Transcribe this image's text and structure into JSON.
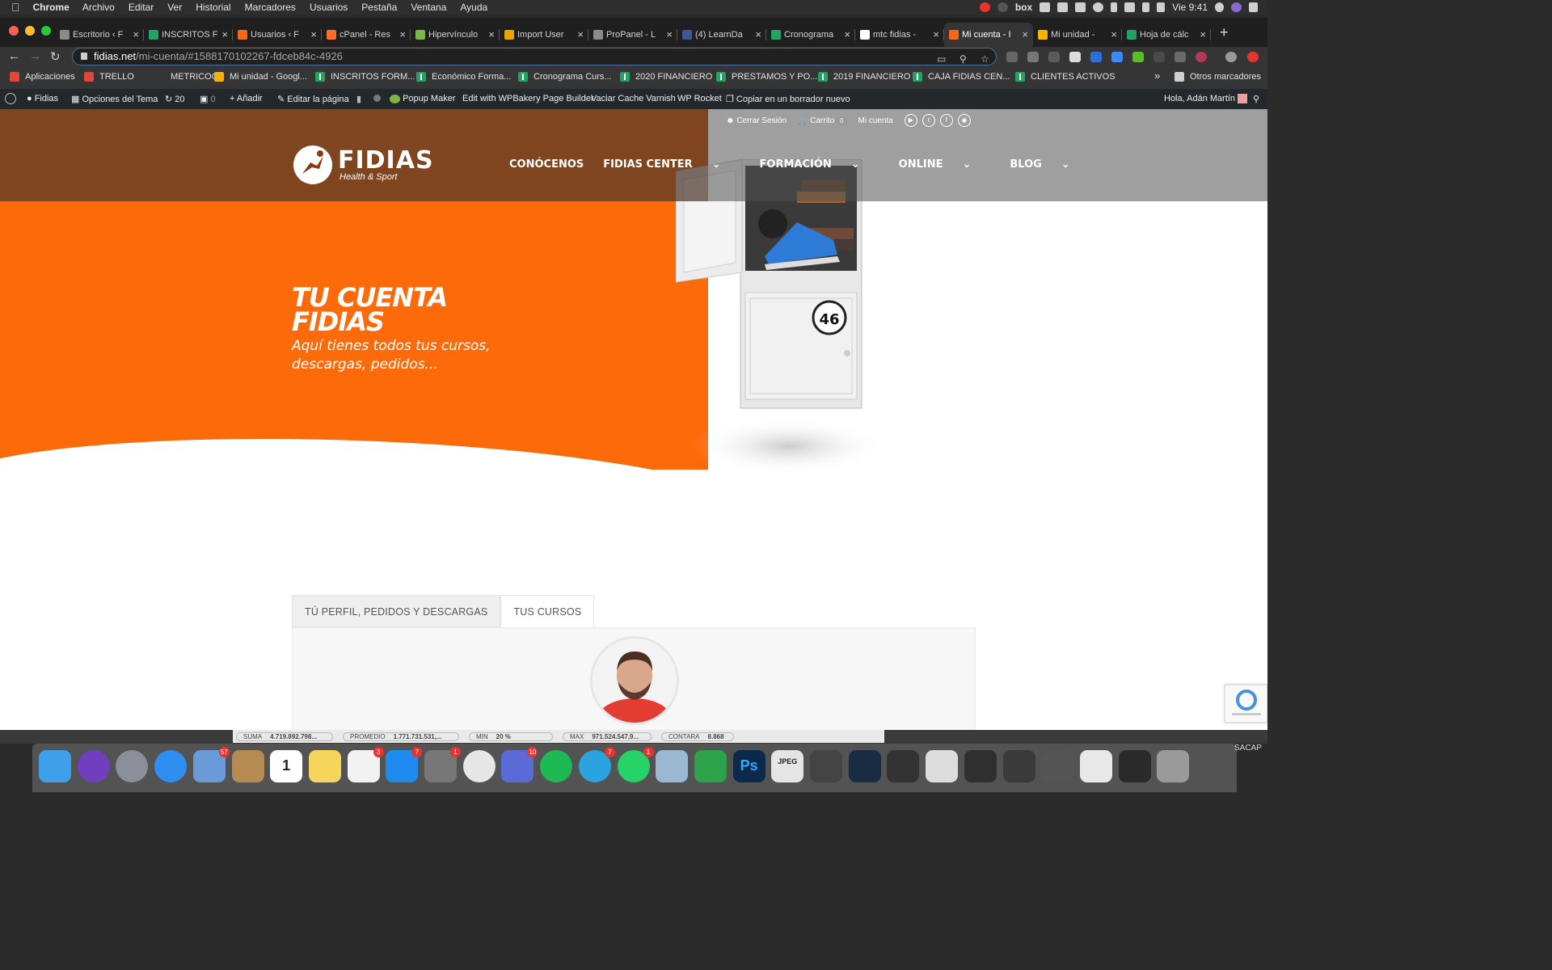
{
  "menubar": {
    "app": "Chrome",
    "items": [
      "Archivo",
      "Editar",
      "Ver",
      "Historial",
      "Marcadores",
      "Usuarios",
      "Pestaña",
      "Ventana",
      "Ayuda"
    ],
    "box_label": "box",
    "clock": "Vie 9:41"
  },
  "tabs": [
    {
      "label": "Escritorio ‹ F",
      "fav": "#8a8a8a"
    },
    {
      "label": "INSCRITOS F",
      "fav": "#1fa463"
    },
    {
      "label": "Usuarios ‹ F",
      "fav": "#f26a18"
    },
    {
      "label": "cPanel - Res",
      "fav": "#ff6c2c"
    },
    {
      "label": "Hipervínculo",
      "fav": "#7ab648"
    },
    {
      "label": "Import User",
      "fav": "#e9a400"
    },
    {
      "label": "ProPanel - L",
      "fav": "#8a8a8a"
    },
    {
      "label": "(4) LearnDa",
      "fav": "#3b5998"
    },
    {
      "label": "Cronograma",
      "fav": "#1fa463"
    },
    {
      "label": "mtc fidias -",
      "fav": "#ffffff"
    },
    {
      "label": "Mi cuenta - I",
      "fav": "#f26a18",
      "active": true
    },
    {
      "label": "Mi unidad -",
      "fav": "#f4b400"
    },
    {
      "label": "Hoja de cálc",
      "fav": "#1fa463"
    }
  ],
  "address": {
    "domain": "fidias.net",
    "path": "/mi-cuenta/#1588170102267-fdceb84c-4926"
  },
  "bookmarks": [
    {
      "label": "Aplicaciones",
      "icon": "apps-grid-icon",
      "color": "#e0473a"
    },
    {
      "label": "TRELLO",
      "icon": "trello-icon",
      "color": "#e0473a"
    },
    {
      "label": "METRICOOL",
      "icon": "metricool-icon",
      "color": "#353535"
    },
    {
      "label": "Mi unidad - Googl...",
      "icon": "drive-icon",
      "color": "#f4b400"
    },
    {
      "label": "INSCRITOS FORM...",
      "icon": "sheets-icon",
      "color": "#1fa463"
    },
    {
      "label": "Económico Forma...",
      "icon": "sheets-icon",
      "color": "#1fa463"
    },
    {
      "label": "Cronograma Curs...",
      "icon": "sheets-icon",
      "color": "#1fa463"
    },
    {
      "label": "2020 FINANCIERO",
      "icon": "sheets-icon",
      "color": "#1fa463"
    },
    {
      "label": "PRESTAMOS Y PO...",
      "icon": "sheets-icon",
      "color": "#1fa463"
    },
    {
      "label": "2019 FINANCIERO",
      "icon": "sheets-icon",
      "color": "#1fa463"
    },
    {
      "label": "CAJA FIDIAS CEN...",
      "icon": "sheets-icon",
      "color": "#1fa463"
    },
    {
      "label": "CLIENTES ACTIVOS",
      "icon": "sheets-icon",
      "color": "#1fa463"
    }
  ],
  "bookmarks_more": "»",
  "bookmarks_other": "Otros marcadores",
  "wpbar": {
    "site": "Fidias",
    "theme_options": "Opciones del Tema",
    "updates": "20",
    "comments": "0",
    "add": "Añadir",
    "edit": "Editar la página",
    "popup": "Popup Maker",
    "wpbakery": "Edit with WPBakery Page Builder",
    "varnish": "Vaciar Cache Varnish",
    "rocket": "WP Rocket",
    "copy": "Copiar en un borrador nuevo",
    "greeting": "Hola, Adán Martín"
  },
  "site": {
    "topbar": {
      "logout": "Cerrar Sesión",
      "cart": "Carrito",
      "cart_count": "0",
      "account": "Mi cuenta"
    },
    "logo_main": "FIDIAS",
    "logo_sub": "Health & Sport",
    "nav": [
      "CONÓCENOS",
      "FIDIAS CENTER",
      "FORMACIÓN",
      "ONLINE",
      "BLOG"
    ],
    "hero_title_1": "TU CUENTA",
    "hero_title_2": "FIDIAS",
    "hero_sub": "Aquí tienes todos tus cursos, descargas, pedidos...",
    "locker_number": "46",
    "tabs": [
      "TÚ PERFIL, PEDIDOS Y DESCARGAS",
      "TUS CURSOS"
    ]
  },
  "sheet_stats": [
    {
      "label": "SUMA",
      "value": "4.719.892.798..."
    },
    {
      "label": "PROMEDIO",
      "value": "1.771.731.531,..."
    },
    {
      "label": "MIN",
      "value": "20 %"
    },
    {
      "label": "MAX",
      "value": "971.524.547,9..."
    },
    {
      "label": "CONTARA",
      "value": "8.868"
    }
  ],
  "dock": [
    {
      "name": "finder",
      "color": "#3fa0ea"
    },
    {
      "name": "siri",
      "color": "#6f3fbf"
    },
    {
      "name": "launchpad",
      "color": "#8a8f99"
    },
    {
      "name": "safari",
      "color": "#2e8ef0"
    },
    {
      "name": "mail",
      "color": "#6b9ad8",
      "badge": "57"
    },
    {
      "name": "contacts",
      "color": "#b58a53"
    },
    {
      "name": "calendar",
      "color": "#ffffff",
      "text": "1"
    },
    {
      "name": "notes",
      "color": "#f6d55c"
    },
    {
      "name": "reminders",
      "color": "#f2f2f2",
      "badge": "3"
    },
    {
      "name": "app-store",
      "color": "#1e8bf1",
      "badge": "7"
    },
    {
      "name": "system-preferences",
      "color": "#777777",
      "badge": "1"
    },
    {
      "name": "chrome",
      "color": "#e6e6e6"
    },
    {
      "name": "omnifocus",
      "color": "#5a6bd8",
      "badge": "10"
    },
    {
      "name": "spotify",
      "color": "#1db954"
    },
    {
      "name": "telegram",
      "color": "#2aa3de",
      "badge": "7"
    },
    {
      "name": "whatsapp",
      "color": "#25d366",
      "badge": "1"
    },
    {
      "name": "preview",
      "color": "#9bb8d3"
    },
    {
      "name": "numbers",
      "color": "#2ca34a"
    },
    {
      "name": "photoshop",
      "color": "#0b2a4a",
      "text": "Ps"
    },
    {
      "name": "jpeg-file",
      "color": "#e5e5e5",
      "text": "JPEG"
    },
    {
      "name": "window-thumb-1",
      "color": "#444444"
    },
    {
      "name": "window-thumb-2",
      "color": "#1a2b44"
    },
    {
      "name": "window-thumb-3",
      "color": "#333333"
    },
    {
      "name": "window-thumb-4",
      "color": "#dcdcdc"
    },
    {
      "name": "window-thumb-5",
      "color": "#2f2f2f"
    },
    {
      "name": "window-thumb-6",
      "color": "#3a3a3a"
    },
    {
      "name": "window-thumb-7",
      "color": "#555555"
    },
    {
      "name": "window-thumb-8",
      "color": "#e8e8e8"
    },
    {
      "name": "window-thumb-9",
      "color": "#2a2a2a"
    },
    {
      "name": "trash",
      "color": "#9a9a9a"
    }
  ],
  "dock_label": "SACAP",
  "colors": {
    "brand_orange": "#fd6a0a"
  }
}
